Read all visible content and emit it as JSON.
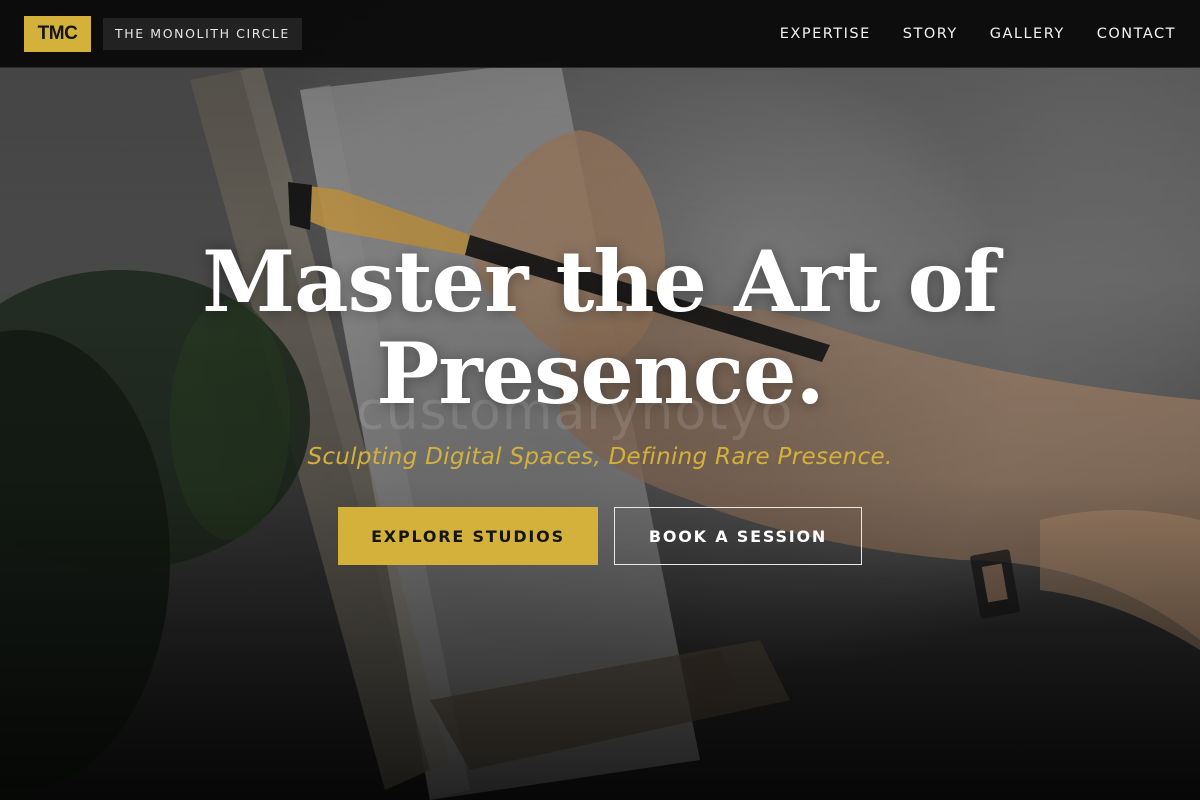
{
  "header": {
    "logo_text": "TMC",
    "brand_name": "THE MONOLITH CIRCLE",
    "nav": [
      {
        "label": "EXPERTISE"
      },
      {
        "label": "STORY"
      },
      {
        "label": "GALLERY"
      },
      {
        "label": "CONTACT"
      }
    ]
  },
  "hero": {
    "headline_line1": "Master the Art of",
    "headline_line2": "Presence.",
    "watermark": "customaryhotyo",
    "subtitle": "Sculpting Digital Spaces, Defining Rare Presence.",
    "primary_cta": "EXPLORE STUDIOS",
    "secondary_cta": "BOOK A SESSION",
    "background_image": "painter-brush-canvas-photo"
  },
  "colors": {
    "accent": "#d4b13b",
    "header_bg": "#0a0a0a",
    "text": "#ffffff"
  }
}
